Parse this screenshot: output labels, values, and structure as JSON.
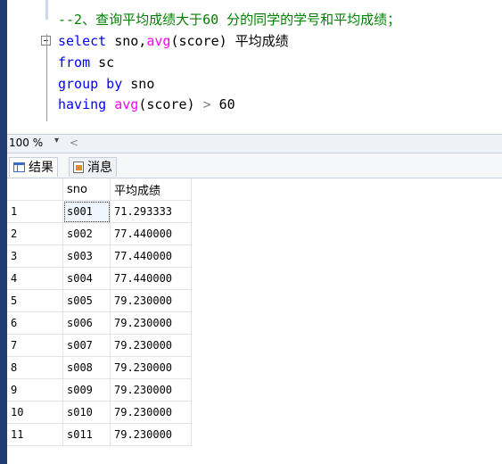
{
  "editor": {
    "comment": "--2、查询平均成绩大于60 分的同学的学号和平均成绩；",
    "line2": {
      "kw": "select",
      "rest1": " sno,",
      "fn": "avg",
      "rest2": "(score) 平均成绩"
    },
    "line3": {
      "kw": "from",
      "rest": " sc"
    },
    "line4": {
      "kw": "group by",
      "rest": " sno"
    },
    "line5": {
      "kw": "having",
      "fn": " avg",
      "rest1": "(score) ",
      "op": ">",
      "rest2": " 60"
    }
  },
  "zoom": {
    "value": "100 %",
    "arrow": "▾",
    "scroll_left": "<"
  },
  "tabs": {
    "results_label": "结果",
    "messages_label": "消息"
  },
  "grid": {
    "columns": [
      "sno",
      "平均成绩"
    ],
    "rows": [
      {
        "n": "1",
        "sno": "s001",
        "avg": "71.293333"
      },
      {
        "n": "2",
        "sno": "s002",
        "avg": "77.440000"
      },
      {
        "n": "3",
        "sno": "s003",
        "avg": "77.440000"
      },
      {
        "n": "4",
        "sno": "s004",
        "avg": "77.440000"
      },
      {
        "n": "5",
        "sno": "s005",
        "avg": "79.230000"
      },
      {
        "n": "6",
        "sno": "s006",
        "avg": "79.230000"
      },
      {
        "n": "7",
        "sno": "s007",
        "avg": "79.230000"
      },
      {
        "n": "8",
        "sno": "s008",
        "avg": "79.230000"
      },
      {
        "n": "9",
        "sno": "s009",
        "avg": "79.230000"
      },
      {
        "n": "10",
        "sno": "s010",
        "avg": "79.230000"
      },
      {
        "n": "11",
        "sno": "s011",
        "avg": "79.230000"
      }
    ]
  }
}
